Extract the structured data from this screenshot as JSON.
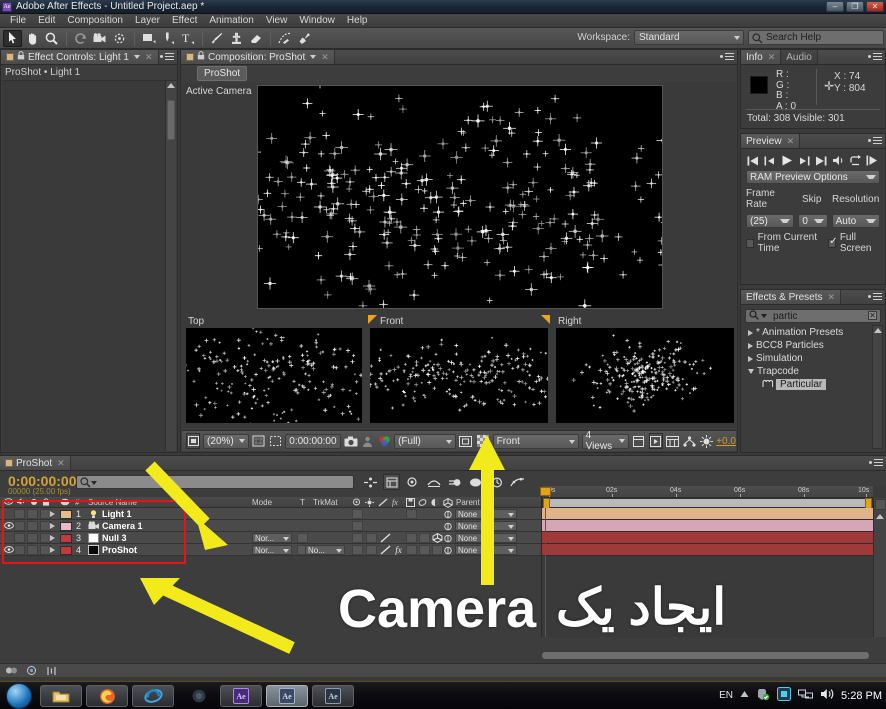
{
  "window": {
    "title": "Adobe After Effects - Untitled Project.aep *",
    "app_icon": "Ae",
    "minimize": "–",
    "maximize": "❐",
    "close": "✕"
  },
  "menubar": {
    "items": [
      "File",
      "Edit",
      "Composition",
      "Layer",
      "Effect",
      "Animation",
      "View",
      "Window",
      "Help"
    ]
  },
  "toolbar": {
    "workspace_label": "Workspace:",
    "workspace_value": "Standard",
    "search_help_placeholder": "Search Help",
    "tools": [
      "selection-tool",
      "hand-tool",
      "zoom-tool",
      "rotation-tool",
      "camera-tool",
      "pan-behind-tool",
      "shape-tool",
      "pen-tool",
      "text-tool",
      "brush-tool",
      "clone-stamp-tool",
      "eraser-tool",
      "roto-brush-tool",
      "puppet-pin-tool"
    ]
  },
  "effect_controls": {
    "tab_label": "Effect Controls: Light 1",
    "breadcrumb": "ProShot • Light 1",
    "close_glyph": "✕"
  },
  "composition": {
    "tab_label": "Composition: ProShot",
    "breadcrumb_chip": "ProShot",
    "active_camera": "Active Camera",
    "quad_views": [
      {
        "label": "Top"
      },
      {
        "label": "Front"
      },
      {
        "label": "Right"
      }
    ],
    "toolbar": {
      "magnification": "(20%)",
      "current_time": "0:00:00:00",
      "resolution": "(Full)",
      "view_3d": "Front",
      "views_count": "4 Views",
      "exposure": "+0.0"
    }
  },
  "info": {
    "tab_label": "Info",
    "tab_label_alt": "Audio",
    "r": "R :",
    "g": "G :",
    "b": "B :",
    "a": "A : 0",
    "x": "X : 74",
    "y": "Y : 804",
    "totals": "Total: 308   Visible: 301"
  },
  "preview": {
    "tab_label": "Preview",
    "ram_preview_options": "RAM Preview Options",
    "frame_rate_label": "Frame Rate",
    "frame_rate_value": "(25)",
    "skip_label": "Skip",
    "skip_value": "0",
    "resolution_label": "Resolution",
    "resolution_value": "Auto",
    "from_current_time": "From Current Time",
    "full_screen": "Full Screen"
  },
  "effects_presets": {
    "tab_label": "Effects & Presets",
    "search_value": "partic",
    "tree": [
      {
        "label": "* Animation Presets",
        "expanded": false,
        "indent": 0
      },
      {
        "label": "BCC8 Particles",
        "expanded": false,
        "indent": 0
      },
      {
        "label": "Simulation",
        "expanded": false,
        "indent": 0
      },
      {
        "label": "Trapcode",
        "expanded": true,
        "indent": 0
      },
      {
        "label": "Particular",
        "expanded": null,
        "indent": 1,
        "selected": true
      }
    ]
  },
  "timeline": {
    "tab_label": "ProShot",
    "current_time": "0:00:00:00",
    "frame_info": "00000 (25.00 fps)",
    "columns": [
      "Mode",
      "T",
      "TrkMat",
      "Parent"
    ],
    "source_name_header": "Source Name",
    "num_header": "#",
    "layers": [
      {
        "num": "1",
        "name": "Light 1",
        "color": "#e6bb8a",
        "type": "light",
        "visible": false,
        "mode": "",
        "trkmat": ""
      },
      {
        "num": "2",
        "name": "Camera 1",
        "color": "#e8b9c8",
        "type": "camera",
        "visible": true,
        "mode": "",
        "trkmat": ""
      },
      {
        "num": "3",
        "name": "Null 3",
        "color": "#c03c3c",
        "type": "solid-white",
        "visible": false,
        "mode": "Nor...",
        "trkmat": ""
      },
      {
        "num": "4",
        "name": "ProShot",
        "color": "#c03c3c",
        "type": "solid-black",
        "visible": true,
        "mode": "Nor...",
        "trkmat": "No..."
      }
    ],
    "parent_value": "None",
    "ruler_ticks": [
      "0s",
      "02s",
      "04s",
      "06s",
      "08s",
      "10s"
    ]
  },
  "annotations": {
    "highlight_box_color": "#ee1111",
    "arrow_color": "#f2ea1a",
    "caption_latin": "Camera",
    "caption_rtl": "ایجاد یک",
    "caption_color": "#ffffff"
  },
  "taskbar": {
    "start_label": "Start",
    "items": [
      "explorer-icon",
      "firefox-icon",
      "internet-explorer-icon",
      "media-icon",
      "after-effects-icon-1",
      "after-effects-icon-2",
      "after-effects-icon-3"
    ],
    "language": "EN",
    "clock": "5:28 PM",
    "tray_icons": [
      "show-hidden-icon",
      "security-icon",
      "display-icon",
      "network-icon",
      "volume-icon"
    ]
  }
}
